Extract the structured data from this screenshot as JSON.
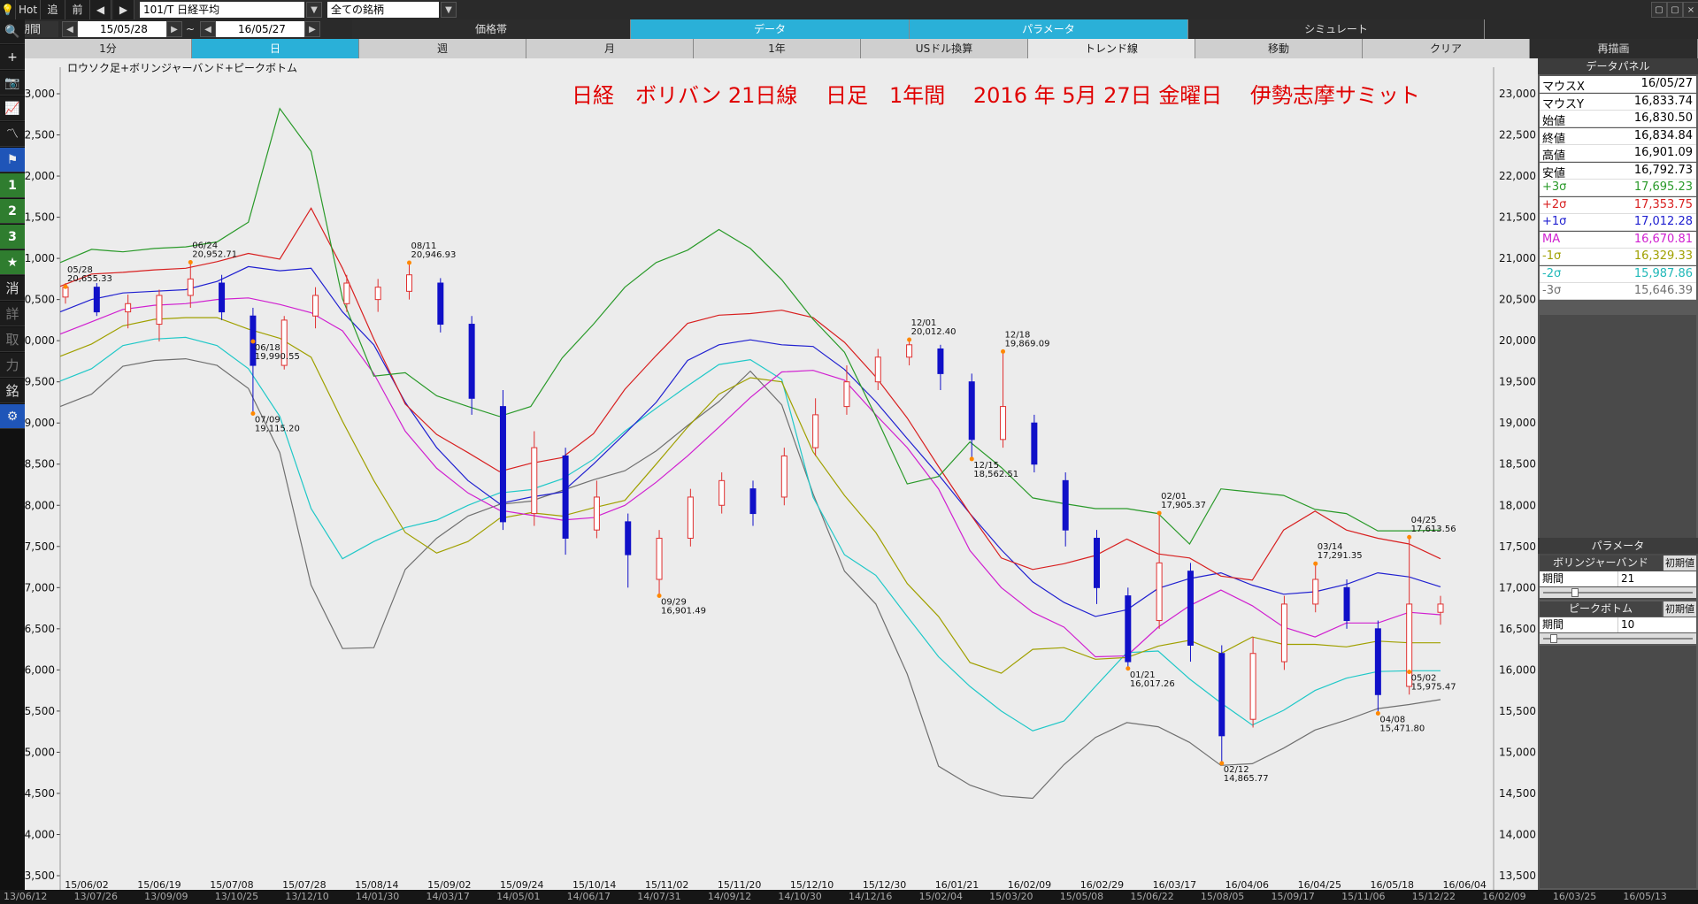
{
  "toolbar": {
    "hot": "Hot",
    "follow": "追",
    "prev": "前",
    "symbol": "101/T 日経平均",
    "universe": "全ての銘柄",
    "period_label": "期間",
    "date_from": "15/05/28",
    "tilde": "~",
    "date_to": "16/05/27"
  },
  "tabs_row1": [
    {
      "label": "価格帯",
      "state": "dk"
    },
    {
      "label": "データ",
      "state": "on"
    },
    {
      "label": "パラメータ",
      "state": "on"
    },
    {
      "label": "シミュレート",
      "state": "dk"
    }
  ],
  "tabs_row2": [
    {
      "label": "1分",
      "state": "normal"
    },
    {
      "label": "日",
      "state": "on"
    },
    {
      "label": "週",
      "state": "normal"
    },
    {
      "label": "月",
      "state": "normal"
    },
    {
      "label": "1年",
      "state": "normal"
    },
    {
      "label": "USドル換算",
      "state": "normal"
    },
    {
      "label": "トレンド線",
      "state": "sel"
    },
    {
      "label": "移動",
      "state": "normal"
    },
    {
      "label": "クリア",
      "state": "normal"
    },
    {
      "label": "再描画",
      "state": "dk"
    }
  ],
  "left_tools": [
    {
      "glyph": "🔍",
      "name": "search-icon"
    },
    {
      "glyph": "+",
      "name": "crosshair-icon"
    },
    {
      "glyph": "📷",
      "name": "camera-icon"
    },
    {
      "glyph": "📈",
      "name": "line-chart-icon"
    },
    {
      "glyph": "〽",
      "name": "trend-icon"
    },
    {
      "glyph": "⚑",
      "name": "flag-icon"
    },
    {
      "glyph": "1",
      "name": "preset-1-button"
    },
    {
      "glyph": "2",
      "name": "preset-2-button"
    },
    {
      "glyph": "3",
      "name": "preset-3-button"
    },
    {
      "glyph": "★",
      "name": "favorite-star-icon"
    },
    {
      "glyph": "消",
      "name": "erase-button"
    },
    {
      "glyph": "詳",
      "name": "detail-button"
    },
    {
      "glyph": "取",
      "name": "trade-button"
    },
    {
      "glyph": "力",
      "name": "power-button"
    },
    {
      "glyph": "銘",
      "name": "stock-button"
    },
    {
      "glyph": "⚙",
      "name": "settings-gear-icon"
    }
  ],
  "chart": {
    "legend": "ロウソク足+ボリンジャーバンド+ピークボトム",
    "headline": "日経　ボリバン 21日線　 日足　1年間　 2016 年 5月 27日 金曜日 　伊勢志摩サミット",
    "colors": {
      "up": "#e03030",
      "down": "#1010c8",
      "p3": "#2a9a2a",
      "p2": "#d82020",
      "p1": "#2020d0",
      "ma": "#d020d0",
      "m1": "#a0a000",
      "m2": "#20c8c8",
      "m3": "#707070",
      "headline": "#e00000"
    }
  },
  "chart_data": {
    "type": "candlestick",
    "title": "日経　ボリバン 21日線　 日足　1年間　 2016 年 5月 27日 金曜日 　伊勢志摩サミット",
    "ylim": [
      13500,
      23000
    ],
    "yticks": [
      13500,
      14000,
      14500,
      15000,
      15500,
      16000,
      16500,
      17000,
      17500,
      18000,
      18500,
      19000,
      19500,
      20000,
      20500,
      21000,
      21500,
      22000,
      22500,
      23000
    ],
    "x_tick_labels": [
      "15/06/02",
      "15/06/19",
      "15/07/08",
      "15/07/28",
      "15/08/14",
      "15/09/02",
      "15/09/24",
      "15/10/14",
      "15/11/02",
      "15/11/20",
      "15/12/10",
      "15/12/30",
      "16/01/21",
      "16/02/09",
      "16/02/29",
      "16/03/17",
      "16/04/06",
      "16/04/25",
      "16/05/18",
      "16/06/04"
    ],
    "moving_average": [
      20080,
      20230,
      20380,
      20430,
      20450,
      20500,
      20520,
      20440,
      20340,
      20120,
      19600,
      18900,
      18450,
      18150,
      17940,
      17880,
      17820,
      17850,
      18000,
      18280,
      18600,
      18950,
      19310,
      19620,
      19640,
      19520,
      19100,
      18700,
      18200,
      17450,
      17000,
      16700,
      16520,
      16160,
      16170,
      16520,
      16780,
      16970,
      16780,
      16520,
      16400,
      16570,
      16570,
      16700,
      16670
    ],
    "upper_1sigma": [
      20350,
      20500,
      20580,
      20600,
      20620,
      20720,
      20900,
      20850,
      20880,
      20350,
      19950,
      19250,
      18700,
      18300,
      18020,
      18100,
      18160,
      18500,
      18870,
      19250,
      19760,
      19950,
      20010,
      19950,
      19930,
      19650,
      19260,
      18810,
      18370,
      17900,
      17460,
      17070,
      16820,
      16650,
      16730,
      16990,
      17110,
      17180,
      17030,
      16920,
      16950,
      17040,
      17180,
      17130,
      17010
    ],
    "upper_2sigma": [
      20660,
      20810,
      20830,
      20860,
      20880,
      20960,
      21060,
      20990,
      21610,
      20880,
      20020,
      19230,
      18860,
      18640,
      18410,
      18510,
      18580,
      18870,
      19410,
      19820,
      20210,
      20310,
      20330,
      20370,
      20280,
      19980,
      19560,
      19060,
      18470,
      17900,
      17360,
      17220,
      17290,
      17390,
      17590,
      17410,
      17360,
      17140,
      17090,
      17700,
      17930,
      17700,
      17600,
      17530,
      17350
    ],
    "upper_3sigma": [
      20950,
      21110,
      21080,
      21120,
      21140,
      21200,
      21440,
      22820,
      22300,
      20510,
      19570,
      19610,
      19330,
      19200,
      19080,
      19200,
      19790,
      20200,
      20650,
      20950,
      21100,
      21350,
      21120,
      20740,
      20260,
      19860,
      19080,
      18260,
      18350,
      18770,
      18460,
      18090,
      18020,
      17960,
      17960,
      17900,
      17530,
      18200,
      18160,
      18120,
      17950,
      17900,
      17690,
      17690,
      17700
    ],
    "lower_1sigma": [
      19810,
      19960,
      20180,
      20260,
      20280,
      20280,
      20140,
      20030,
      19800,
      19020,
      18300,
      17670,
      17420,
      17560,
      17840,
      17910,
      17870,
      17970,
      18060,
      18500,
      18950,
      19350,
      19550,
      19500,
      18650,
      18120,
      17670,
      17050,
      16650,
      16090,
      15960,
      16250,
      16270,
      16130,
      16150,
      16290,
      16360,
      16200,
      16400,
      16310,
      16310,
      16280,
      16350,
      16330,
      16330
    ],
    "lower_2sigma": [
      19510,
      19660,
      19940,
      20020,
      20040,
      19940,
      19660,
      19080,
      17960,
      17350,
      17560,
      17730,
      17820,
      18000,
      18150,
      18190,
      18320,
      18560,
      18900,
      19180,
      19450,
      19710,
      19770,
      19530,
      18100,
      17400,
      17150,
      16650,
      16160,
      15800,
      15500,
      15260,
      15380,
      15800,
      16210,
      16230,
      15890,
      15600,
      15330,
      15510,
      15750,
      15900,
      15980,
      15990,
      15990
    ],
    "lower_3sigma": [
      19200,
      19350,
      19690,
      19760,
      19780,
      19700,
      19420,
      18640,
      17030,
      16260,
      16270,
      17220,
      17600,
      17870,
      18010,
      18050,
      18180,
      18310,
      18420,
      18660,
      18970,
      19260,
      19630,
      19220,
      18140,
      17200,
      16800,
      15950,
      14830,
      14600,
      14470,
      14440,
      14850,
      15180,
      15360,
      15310,
      15120,
      14840,
      14860,
      15050,
      15270,
      15390,
      15530,
      15580,
      15640
    ],
    "candles_sampled": [
      {
        "o": 20530,
        "c": 20650,
        "h": 20700,
        "l": 20450
      },
      {
        "o": 20650,
        "c": 20350,
        "h": 20700,
        "l": 20300
      },
      {
        "o": 20350,
        "c": 20450,
        "h": 20560,
        "l": 20150
      },
      {
        "o": 20200,
        "c": 20550,
        "h": 20620,
        "l": 19990
      },
      {
        "o": 20550,
        "c": 20750,
        "h": 20950,
        "l": 20400
      },
      {
        "o": 20700,
        "c": 20350,
        "h": 20800,
        "l": 20250
      },
      {
        "o": 20300,
        "c": 19700,
        "h": 20400,
        "l": 19115
      },
      {
        "o": 19700,
        "c": 20250,
        "h": 20300,
        "l": 19650
      },
      {
        "o": 20300,
        "c": 20550,
        "h": 20650,
        "l": 20150
      },
      {
        "o": 20450,
        "c": 20700,
        "h": 20800,
        "l": 20350
      },
      {
        "o": 20500,
        "c": 20650,
        "h": 20750,
        "l": 20350
      },
      {
        "o": 20600,
        "c": 20800,
        "h": 20946,
        "l": 20500
      },
      {
        "o": 20700,
        "c": 20200,
        "h": 20760,
        "l": 20100
      },
      {
        "o": 20200,
        "c": 19300,
        "h": 20300,
        "l": 19100
      },
      {
        "o": 19200,
        "c": 17800,
        "h": 19400,
        "l": 17700
      },
      {
        "o": 17900,
        "c": 18700,
        "h": 18900,
        "l": 17750
      },
      {
        "o": 18600,
        "c": 17600,
        "h": 18700,
        "l": 17400
      },
      {
        "o": 17700,
        "c": 18100,
        "h": 18300,
        "l": 17600
      },
      {
        "o": 17800,
        "c": 17400,
        "h": 17900,
        "l": 17000
      },
      {
        "o": 17100,
        "c": 17600,
        "h": 17700,
        "l": 16901
      },
      {
        "o": 17600,
        "c": 18100,
        "h": 18200,
        "l": 17500
      },
      {
        "o": 18000,
        "c": 18300,
        "h": 18400,
        "l": 17900
      },
      {
        "o": 18200,
        "c": 17900,
        "h": 18300,
        "l": 17750
      },
      {
        "o": 18100,
        "c": 18600,
        "h": 18700,
        "l": 18000
      },
      {
        "o": 18700,
        "c": 19100,
        "h": 19300,
        "l": 18600
      },
      {
        "o": 19200,
        "c": 19500,
        "h": 19700,
        "l": 19100
      },
      {
        "o": 19500,
        "c": 19800,
        "h": 19900,
        "l": 19400
      },
      {
        "o": 19800,
        "c": 19950,
        "h": 20012,
        "l": 19700
      },
      {
        "o": 19900,
        "c": 19600,
        "h": 19950,
        "l": 19400
      },
      {
        "o": 19500,
        "c": 18800,
        "h": 19600,
        "l": 18562
      },
      {
        "o": 18800,
        "c": 19200,
        "h": 19869,
        "l": 18700
      },
      {
        "o": 19000,
        "c": 18500,
        "h": 19100,
        "l": 18400
      },
      {
        "o": 18300,
        "c": 17700,
        "h": 18400,
        "l": 17500
      },
      {
        "o": 17600,
        "c": 17000,
        "h": 17700,
        "l": 16800
      },
      {
        "o": 16900,
        "c": 16100,
        "h": 17000,
        "l": 16017
      },
      {
        "o": 16600,
        "c": 17300,
        "h": 17906,
        "l": 16500
      },
      {
        "o": 17200,
        "c": 16300,
        "h": 17300,
        "l": 16100
      },
      {
        "o": 16200,
        "c": 15200,
        "h": 16300,
        "l": 14865
      },
      {
        "o": 15400,
        "c": 16200,
        "h": 16400,
        "l": 15300
      },
      {
        "o": 16100,
        "c": 16800,
        "h": 16900,
        "l": 16000
      },
      {
        "o": 16800,
        "c": 17100,
        "h": 17291,
        "l": 16700
      },
      {
        "o": 17000,
        "c": 16600,
        "h": 17100,
        "l": 16500
      },
      {
        "o": 16500,
        "c": 15700,
        "h": 16600,
        "l": 15471
      },
      {
        "o": 15800,
        "c": 16800,
        "h": 17613,
        "l": 15700
      },
      {
        "o": 16700,
        "c": 16800,
        "h": 16900,
        "l": 16550
      }
    ],
    "annotations": [
      {
        "date": "05/28",
        "value": "20,655.33"
      },
      {
        "date": "06/24",
        "value": "20,952.71"
      },
      {
        "date": "06/18",
        "value": "19,990.55"
      },
      {
        "date": "07/09",
        "value": "19,115.20"
      },
      {
        "date": "08/11",
        "value": "20,946.93"
      },
      {
        "date": "09/29",
        "value": "16,901.49"
      },
      {
        "date": "12/01",
        "value": "20,012.40"
      },
      {
        "date": "12/18",
        "value": "19,869.09"
      },
      {
        "date": "12/15",
        "value": "18,562.51"
      },
      {
        "date": "02/01",
        "value": "17,905.37"
      },
      {
        "date": "01/21",
        "value": "16,017.26"
      },
      {
        "date": "02/12",
        "value": "14,865.77"
      },
      {
        "date": "03/14",
        "value": "17,291.35"
      },
      {
        "date": "04/08",
        "value": "15,471.80"
      },
      {
        "date": "04/25",
        "value": "17,613.56"
      },
      {
        "date": "05/02",
        "value": "15,975.47"
      }
    ]
  },
  "data_panel": {
    "title": "データパネル",
    "rows": [
      {
        "k": "マウスX",
        "v": "16/05/27",
        "color": "#000000"
      },
      {
        "k": "マウスY",
        "v": "16,833.74",
        "color": "#000000"
      },
      {
        "k": "始値",
        "v": "16,830.50",
        "color": "#000000"
      },
      {
        "k": "終値",
        "v": "16,834.84",
        "color": "#000000"
      },
      {
        "k": "高値",
        "v": "16,901.09",
        "color": "#000000"
      },
      {
        "k": "安値",
        "v": "16,792.73",
        "color": "#000000"
      },
      {
        "k": "+3σ",
        "v": "17,695.23",
        "color": "#2a9a2a"
      },
      {
        "k": "+2σ",
        "v": "17,353.75",
        "color": "#d82020"
      },
      {
        "k": "+1σ",
        "v": "17,012.28",
        "color": "#2020d0"
      },
      {
        "k": "MA",
        "v": "16,670.81",
        "color": "#d020d0"
      },
      {
        "k": "-1σ",
        "v": "16,329.33",
        "color": "#a0a000"
      },
      {
        "k": "-2σ",
        "v": "15,987.86",
        "color": "#20b8b8"
      },
      {
        "k": "-3σ",
        "v": "15,646.39",
        "color": "#707070"
      }
    ]
  },
  "param_panel": {
    "title": "パラメータ",
    "bollinger": {
      "title": "ボリンジャーバンド",
      "init": "初期値",
      "label": "期間",
      "value": "21",
      "slider_fraction": 0.2
    },
    "peak": {
      "title": "ピークボトム",
      "init": "初期値",
      "label": "期間",
      "value": "10",
      "slider_fraction": 0.05
    }
  },
  "bottom_dates": [
    "13/06/12",
    "13/07/26",
    "13/09/09",
    "13/10/25",
    "13/12/10",
    "14/01/30",
    "14/03/17",
    "14/05/01",
    "14/06/17",
    "14/07/31",
    "14/09/12",
    "14/10/30",
    "14/12/16",
    "15/02/04",
    "15/03/20",
    "15/05/08",
    "15/06/22",
    "15/08/05",
    "15/09/17",
    "15/11/06",
    "15/12/22",
    "16/02/09",
    "16/03/25",
    "16/05/13"
  ]
}
